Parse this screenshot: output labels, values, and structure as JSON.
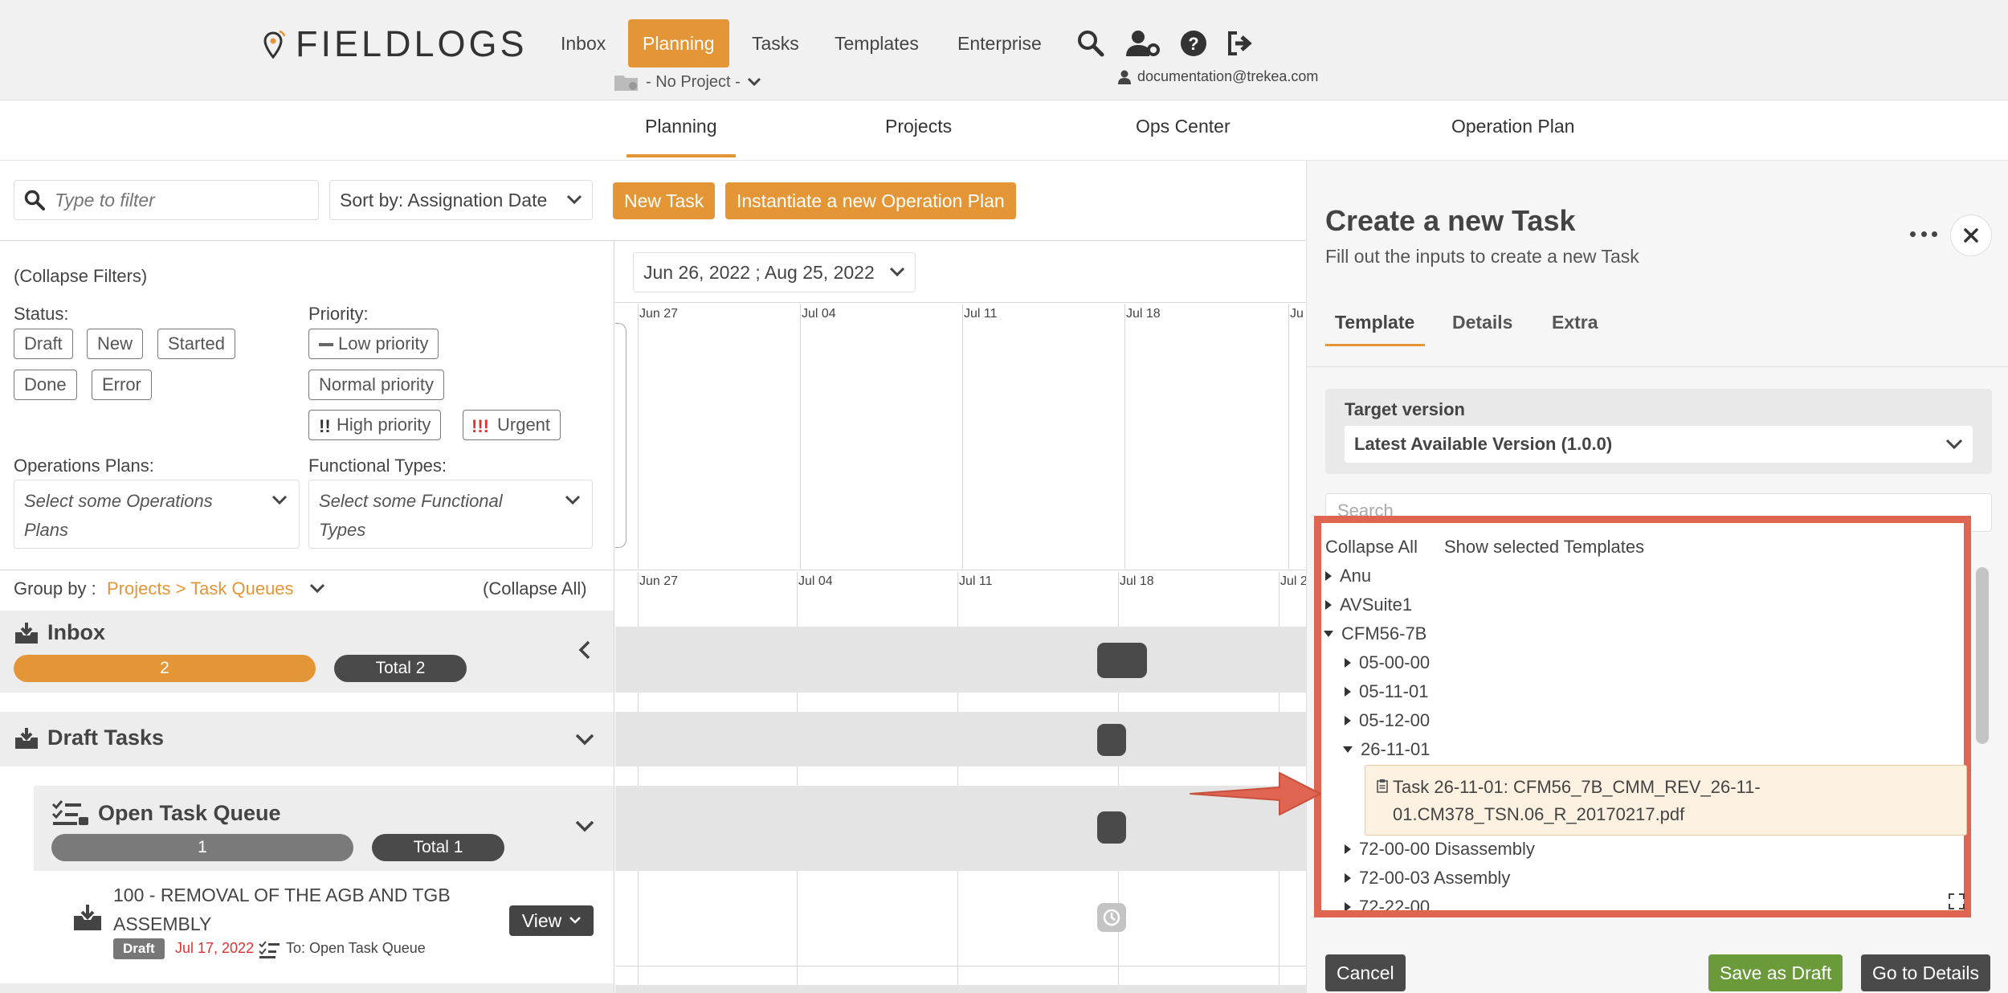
{
  "header": {
    "brand": "FIELDLOGS",
    "nav": [
      "Inbox",
      "Planning",
      "Tasks",
      "Templates",
      "Enterprise"
    ],
    "active_nav": "Planning",
    "project_selector": "- No Project -",
    "user_email": "documentation@trekea.com"
  },
  "subnav": {
    "items": [
      "Planning",
      "Projects",
      "Ops Center",
      "Operation Plan"
    ]
  },
  "toolbar": {
    "filter_placeholder": "Type to filter",
    "sort_label": "Sort by: Assignation Date",
    "new_task": "New Task",
    "instantiate_plan": "Instantiate a new Operation Plan"
  },
  "filters": {
    "collapse": "(Collapse Filters)",
    "status_label": "Status:",
    "statuses": [
      "Draft",
      "New",
      "Started",
      "Done",
      "Error"
    ],
    "priority_label": "Priority:",
    "priorities": [
      "Low priority",
      "Normal priority",
      "High priority",
      "Urgent"
    ],
    "ops_plans_label": "Operations Plans:",
    "ops_plans_placeholder": "Select some Operations Plans",
    "functional_types_label": "Functional Types:",
    "functional_types_placeholder": "Select some Functional Types"
  },
  "timeline": {
    "date_range": "Jun 26, 2022 ; Aug 25, 2022",
    "ticks_top": [
      "Jun 27",
      "Jul 04",
      "Jul 11",
      "Jul 18",
      "Ju"
    ],
    "ticks_bottom": [
      "Jun 27",
      "Jul 04",
      "Jul 11",
      "Jul 18",
      "Jul 2"
    ]
  },
  "groups": {
    "group_by_label": "Group by :",
    "group_by_value": "Projects > Task Queues",
    "collapse_all": "(Collapse All)",
    "inbox": {
      "title": "Inbox",
      "count": "2",
      "total": "Total 2"
    },
    "draft": {
      "title": "Draft Tasks"
    },
    "queue": {
      "title": "Open Task Queue",
      "count": "1",
      "total": "Total 1"
    },
    "task": {
      "title": "100 - REMOVAL OF THE AGB AND TGB ASSEMBLY",
      "status": "Draft",
      "date": "Jul 17, 2022",
      "assignee": "To: Open Task Queue",
      "view": "View"
    }
  },
  "panel": {
    "title": "Create a new Task",
    "subtitle": "Fill out the inputs to create a new Task",
    "tabs": [
      "Template",
      "Details",
      "Extra"
    ],
    "active_tab": "Template",
    "target_version_label": "Target version",
    "target_version_value": "Latest Available Version (1.0.0)",
    "search_placeholder": "Search",
    "collapse_all": "Collapse All",
    "show_selected": "Show selected Templates",
    "tree": [
      {
        "label": "Anu",
        "level": 0,
        "expanded": false
      },
      {
        "label": "AVSuite1",
        "level": 0,
        "expanded": false
      },
      {
        "label": "CFM56-7B",
        "level": 0,
        "expanded": true
      },
      {
        "label": "05-00-00",
        "level": 1,
        "expanded": false
      },
      {
        "label": "05-11-01",
        "level": 1,
        "expanded": false
      },
      {
        "label": "05-12-00",
        "level": 1,
        "expanded": false
      },
      {
        "label": "26-11-01",
        "level": 1,
        "expanded": true
      },
      {
        "label": "72-00-00 Disassembly",
        "level": 1,
        "expanded": false
      },
      {
        "label": "72-00-03 Assembly",
        "level": 1,
        "expanded": false
      },
      {
        "label": "72-22-00",
        "level": 1,
        "expanded": false
      }
    ],
    "selected_task_line1": "Task 26-11-01: CFM56_7B_CMM_REV_26-11-",
    "selected_task_line2": "01.CM378_TSN.06_R_20170217.pdf",
    "buttons": {
      "cancel": "Cancel",
      "save_draft": "Save as Draft",
      "go_details": "Go to Details"
    }
  },
  "colors": {
    "accent": "#e49637",
    "annotation": "#e06452",
    "success": "#6b9a3b",
    "dark": "#4a4a4a"
  }
}
